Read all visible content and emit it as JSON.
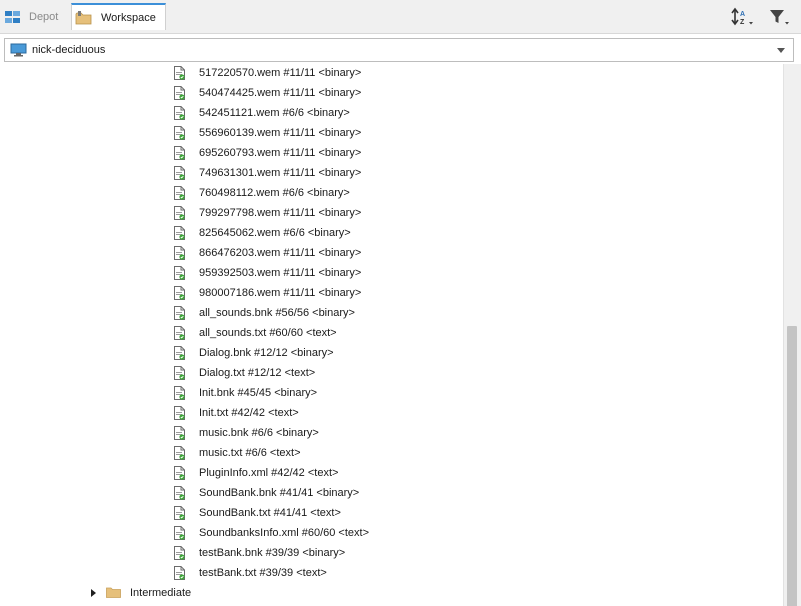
{
  "tabs": [
    {
      "label": "Depot",
      "icon": "depot-icon",
      "active": false
    },
    {
      "label": "Workspace",
      "icon": "workspace-icon",
      "active": true
    }
  ],
  "toolbar": {
    "sort_icon": "sort-az-icon",
    "filter_icon": "filter-icon"
  },
  "workspace_selector": {
    "value": "nick-deciduous",
    "icon": "computer-icon"
  },
  "files": [
    {
      "label": "517220570.wem #11/11 <binary>"
    },
    {
      "label": "540474425.wem #11/11 <binary>"
    },
    {
      "label": "542451121.wem #6/6 <binary>"
    },
    {
      "label": "556960139.wem #11/11 <binary>"
    },
    {
      "label": "695260793.wem #11/11 <binary>"
    },
    {
      "label": "749631301.wem #11/11 <binary>"
    },
    {
      "label": "760498112.wem #6/6 <binary>"
    },
    {
      "label": "799297798.wem #11/11 <binary>"
    },
    {
      "label": "825645062.wem #6/6 <binary>"
    },
    {
      "label": "866476203.wem #11/11 <binary>"
    },
    {
      "label": "959392503.wem #11/11 <binary>"
    },
    {
      "label": "980007186.wem #11/11 <binary>"
    },
    {
      "label": "all_sounds.bnk #56/56 <binary>"
    },
    {
      "label": "all_sounds.txt #60/60 <text>"
    },
    {
      "label": "Dialog.bnk #12/12 <binary>"
    },
    {
      "label": "Dialog.txt #12/12 <text>"
    },
    {
      "label": "Init.bnk #45/45 <binary>"
    },
    {
      "label": "Init.txt #42/42 <text>"
    },
    {
      "label": "music.bnk #6/6 <binary>"
    },
    {
      "label": "music.txt #6/6 <text>"
    },
    {
      "label": "PluginInfo.xml #42/42 <text>"
    },
    {
      "label": "SoundBank.bnk #41/41 <binary>"
    },
    {
      "label": "SoundBank.txt #41/41 <text>"
    },
    {
      "label": "SoundbanksInfo.xml #60/60 <text>"
    },
    {
      "label": "testBank.bnk #39/39 <binary>"
    },
    {
      "label": "testBank.txt #39/39 <text>"
    }
  ],
  "folders": [
    {
      "label": "Intermediate",
      "expanded": false
    }
  ],
  "colors": {
    "accent": "#3c8fd8",
    "file_icon_green": "#3aa335",
    "folder": "#e6c07b"
  }
}
